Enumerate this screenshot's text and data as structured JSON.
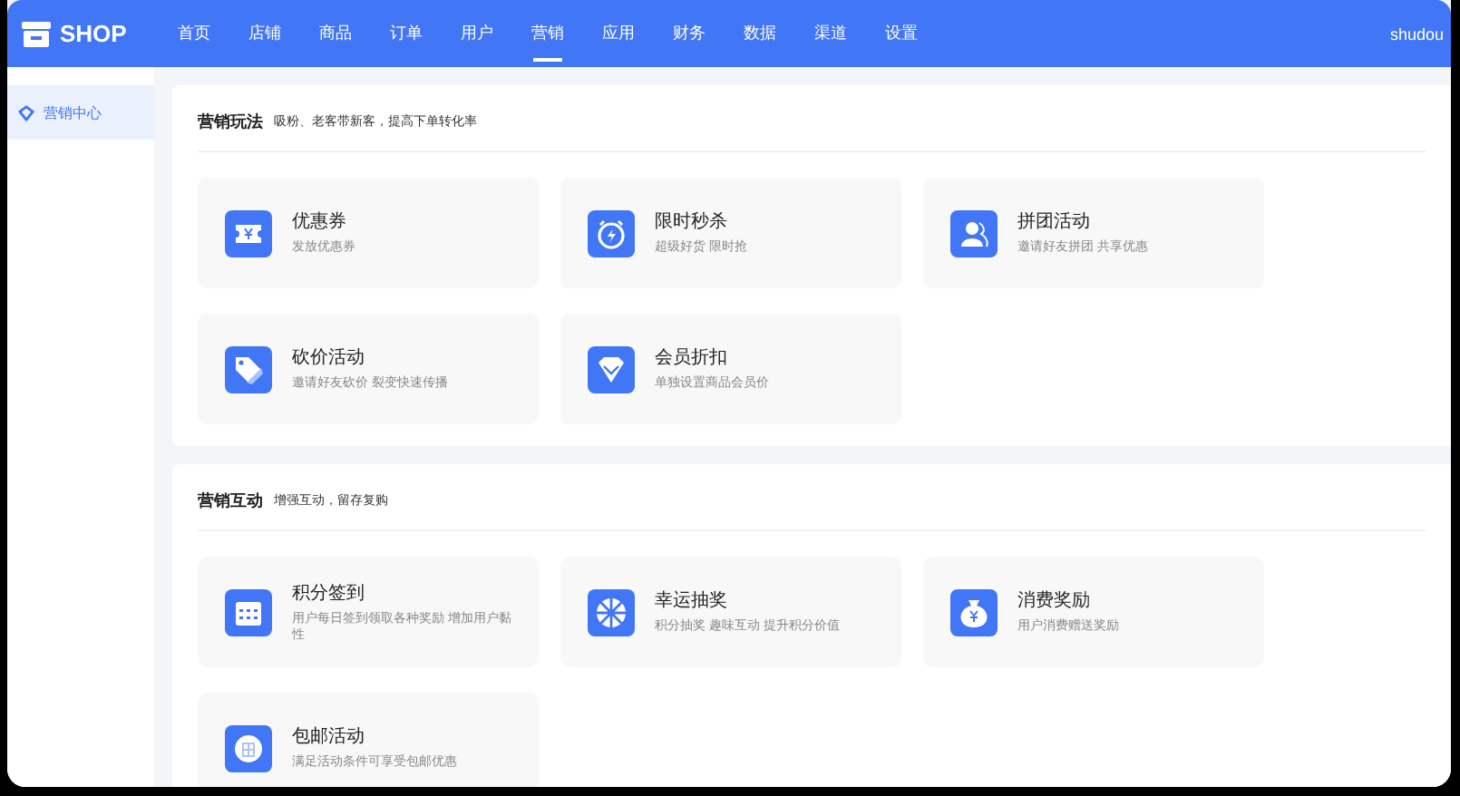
{
  "header": {
    "logo": "SHOP",
    "nav": [
      {
        "label": "首页",
        "selected": false
      },
      {
        "label": "店铺",
        "selected": false
      },
      {
        "label": "商品",
        "selected": false
      },
      {
        "label": "订单",
        "selected": false
      },
      {
        "label": "用户",
        "selected": false
      },
      {
        "label": "营销",
        "selected": true
      },
      {
        "label": "应用",
        "selected": false
      },
      {
        "label": "财务",
        "selected": false
      },
      {
        "label": "数据",
        "selected": false
      },
      {
        "label": "渠道",
        "selected": false
      },
      {
        "label": "设置",
        "selected": false
      }
    ],
    "user": "shudou"
  },
  "sidebar": {
    "items": [
      {
        "label": "营销中心",
        "selected": true
      }
    ]
  },
  "sections": [
    {
      "title": "营销玩法",
      "subtitle": "吸粉、老客带新客，提高下单转化率",
      "cards": [
        {
          "title": "优惠券",
          "desc": "发放优惠券"
        },
        {
          "title": "限时秒杀",
          "desc": "超级好货 限时抢"
        },
        {
          "title": "拼团活动",
          "desc": "邀请好友拼团 共享优惠"
        },
        {
          "title": "砍价活动",
          "desc": "邀请好友砍价 裂变快速传播"
        },
        {
          "title": "会员折扣",
          "desc": "单独设置商品会员价"
        }
      ]
    },
    {
      "title": "营销互动",
      "subtitle": "增强互动，留存复购",
      "cards": [
        {
          "title": "积分签到",
          "desc": "用户每日签到领取各种奖励 增加用户黏性"
        },
        {
          "title": "幸运抽奖",
          "desc": "积分抽奖 趣味互动 提升积分价值"
        },
        {
          "title": "消费奖励",
          "desc": "用户消费赠送奖励"
        },
        {
          "title": "包邮活动",
          "desc": "满足活动条件可享受包邮优惠"
        }
      ]
    }
  ]
}
